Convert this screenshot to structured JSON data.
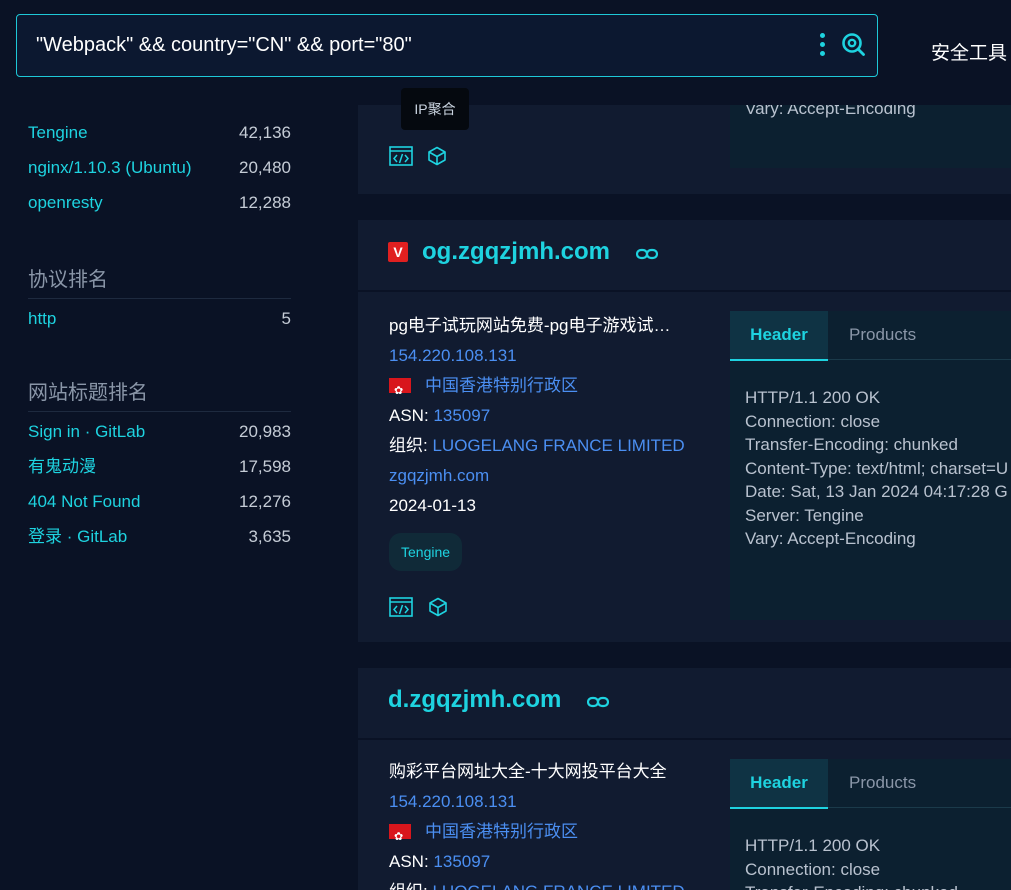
{
  "search": {
    "query": "\"Webpack\" && country=\"CN\" && port=\"80\""
  },
  "nav": {
    "tools_label": "安全工具"
  },
  "tooltip": {
    "text": "IP聚合"
  },
  "sidebar": {
    "server_rows": [
      {
        "label": "Tengine",
        "value": "42,136"
      },
      {
        "label": "nginx/1.10.3 (Ubuntu)",
        "value": "20,480"
      },
      {
        "label": "openresty",
        "value": "12,288"
      }
    ],
    "protocol_title": "协议排名",
    "protocol_rows": [
      {
        "label": "http",
        "value": "5"
      }
    ],
    "title_rank_title": "网站标题排名",
    "title_rows": [
      {
        "label": "Sign in · GitLab",
        "value": "20,983"
      },
      {
        "label": "有鬼动漫",
        "value": "17,598"
      },
      {
        "label": "404 Not Found",
        "value": "12,276"
      },
      {
        "label": "登录 · GitLab",
        "value": "3,635"
      }
    ]
  },
  "card0": {
    "header_tail": "Vary: Accept-Encoding"
  },
  "card1": {
    "badge": "V",
    "domain": "og.zgqzjmh.com",
    "title": "pg电子试玩网站免费-pg电子游戏试…",
    "ip": "154.220.108.131",
    "region": "中国香港特别行政区",
    "asn_label": "ASN:",
    "asn": "135097",
    "org_label": "组织:",
    "org": "LUOGELANG FRANCE LIMITED",
    "site": "zgqzjmh.com",
    "date": "2024-01-13",
    "tag": "Tengine",
    "tab_header": "Header",
    "tab_products": "Products",
    "header_lines": [
      "HTTP/1.1 200 OK",
      "Connection: close",
      "Transfer-Encoding: chunked",
      "Content-Type: text/html; charset=U",
      "Date: Sat, 13 Jan 2024 04:17:28 G",
      "Server: Tengine",
      "Vary: Accept-Encoding"
    ]
  },
  "card2": {
    "domain": "d.zgqzjmh.com",
    "title": "购彩平台网址大全-十大网投平台大全",
    "ip": "154.220.108.131",
    "region": "中国香港特别行政区",
    "asn_label": "ASN:",
    "asn": "135097",
    "org_label": "组织:",
    "org": "LUOGELANG FRANCE LIMITED",
    "tab_header": "Header",
    "tab_products": "Products",
    "header_lines": [
      "HTTP/1.1 200 OK",
      "Connection: close",
      "Transfer-Encoding: chunked"
    ]
  }
}
